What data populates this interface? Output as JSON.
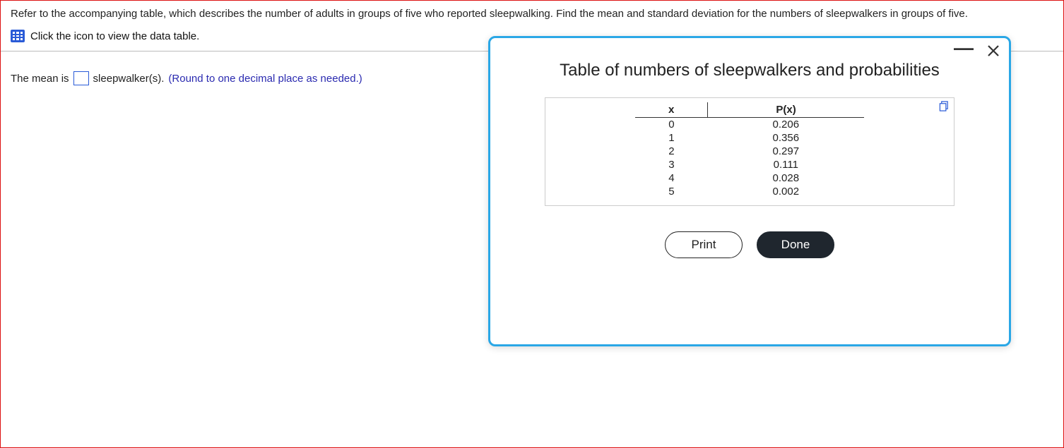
{
  "question": {
    "text": "Refer to the accompanying table, which describes the number of adults in groups of five who reported sleepwalking. Find the mean and standard deviation for the numbers of sleepwalkers in groups of five.",
    "icon_link_text": "Click the icon to view the data table."
  },
  "answer": {
    "prefix": "The mean is",
    "suffix": "sleepwalker(s).",
    "hint": "(Round to one decimal place as needed.)",
    "input_value": ""
  },
  "dialog": {
    "title": "Table of numbers of sleepwalkers and probabilities",
    "headers": {
      "x": "x",
      "px": "P(x)"
    },
    "rows": [
      {
        "x": "0",
        "px": "0.206"
      },
      {
        "x": "1",
        "px": "0.356"
      },
      {
        "x": "2",
        "px": "0.297"
      },
      {
        "x": "3",
        "px": "0.111"
      },
      {
        "x": "4",
        "px": "0.028"
      },
      {
        "x": "5",
        "px": "0.002"
      }
    ],
    "buttons": {
      "print": "Print",
      "done": "Done"
    }
  },
  "chart_data": {
    "type": "table",
    "title": "Table of numbers of sleepwalkers and probabilities",
    "columns": [
      "x",
      "P(x)"
    ],
    "rows": [
      [
        0,
        0.206
      ],
      [
        1,
        0.356
      ],
      [
        2,
        0.297
      ],
      [
        3,
        0.111
      ],
      [
        4,
        0.028
      ],
      [
        5,
        0.002
      ]
    ]
  }
}
